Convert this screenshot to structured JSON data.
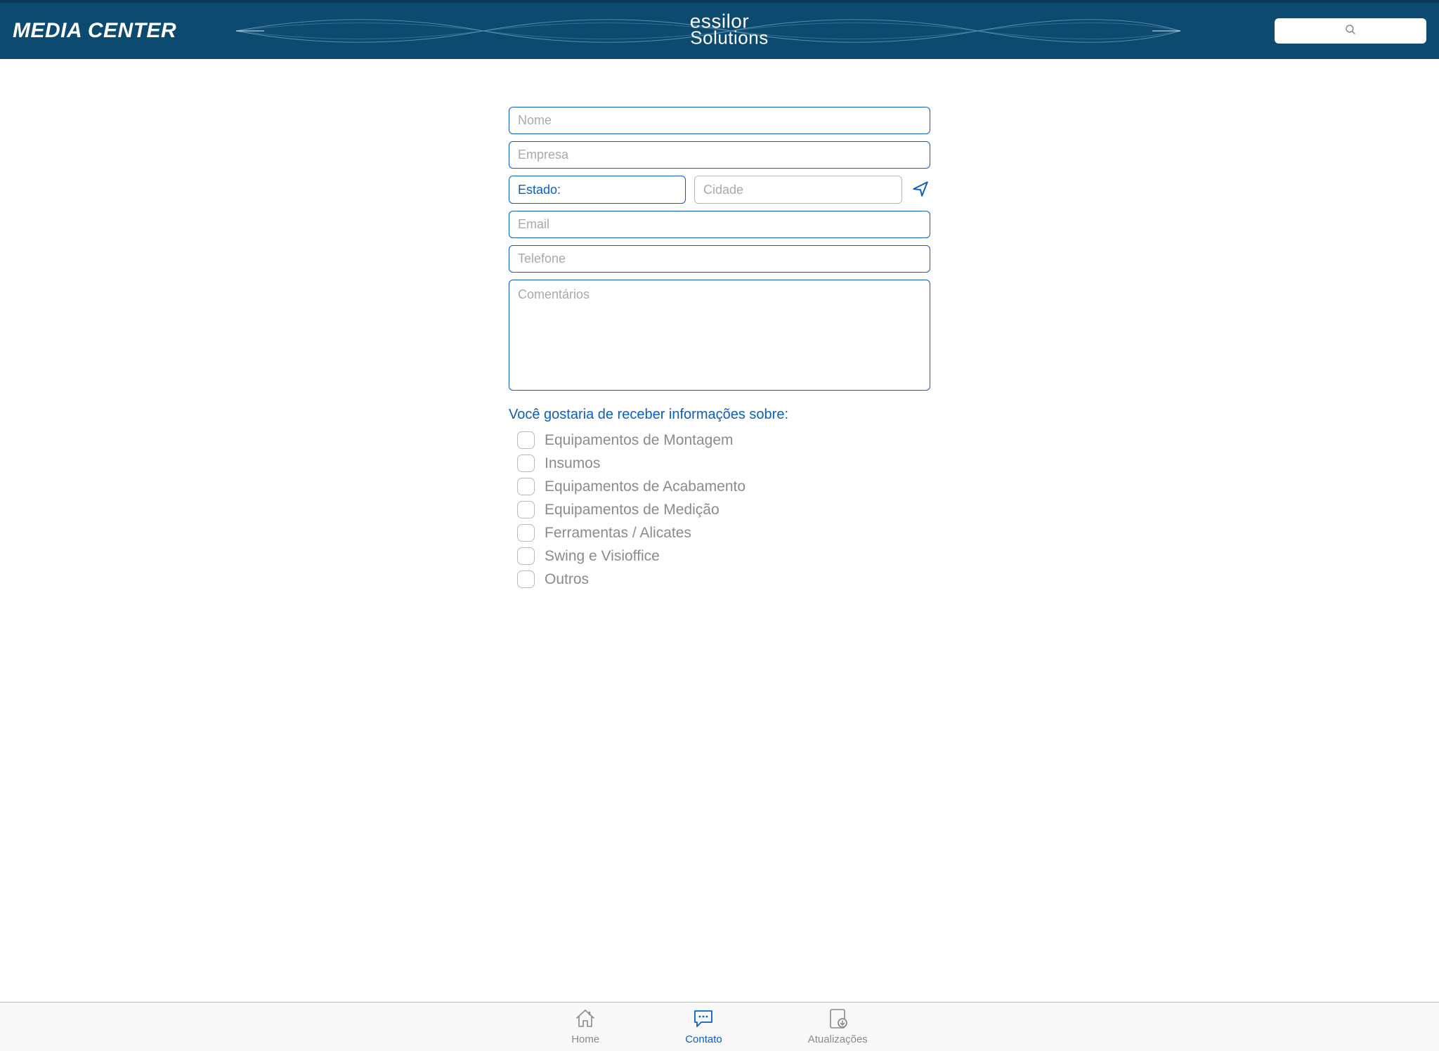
{
  "header": {
    "title": "MEDIA CENTER",
    "brand_line1": "essilor",
    "brand_line2": "Solutions",
    "search_placeholder": ""
  },
  "form": {
    "nome_placeholder": "Nome",
    "empresa_placeholder": "Empresa",
    "estado_label": "Estado:",
    "cidade_placeholder": "Cidade",
    "email_placeholder": "Email",
    "telefone_placeholder": "Telefone",
    "comentarios_placeholder": "Comentários",
    "section_title": "Você gostaria de receber informações sobre:",
    "options": [
      "Equipamentos de Montagem",
      "Insumos",
      "Equipamentos de Acabamento",
      "Equipamentos de Medição",
      "Ferramentas / Alicates",
      "Swing e Visioffice",
      "Outros"
    ]
  },
  "tabs": {
    "home": "Home",
    "contato": "Contato",
    "atualizacoes": "Atualizações",
    "active": "contato"
  },
  "colors": {
    "header_bg": "#0d4a70",
    "accent": "#0a5fbf",
    "muted": "#8b8b8b"
  }
}
